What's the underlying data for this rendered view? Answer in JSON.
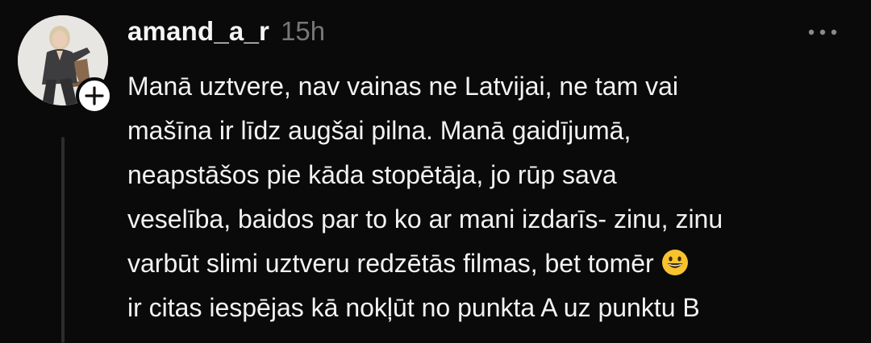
{
  "post": {
    "author": {
      "username": "amand_a_r",
      "timestamp": "15h"
    },
    "avatar_icon": "profile-photo",
    "follow_icon": "plus-icon",
    "more_icon": "ellipsis-icon",
    "body_lines": [
      "Manā uztvere, nav vainas ne Latvijai, ne tam vai",
      "mašīna ir līdz augšai pilna. Manā gaidījumā,",
      "neapstāšos pie kāda stopētāja, jo rūp sava",
      "veselība, baidos par to ko ar mani izdarīs- zinu, zinu",
      "varbūt slimi uztveru redzētās filmas, bet tomēr",
      "ir citas iespējas kā nokļūt no punkta A uz punktu B"
    ],
    "emoji": "grinning-face",
    "colors": {
      "background": "#0a0a0a",
      "text": "#f2f2f2",
      "muted": "#777777",
      "thread_line": "#2c2c2c"
    }
  }
}
